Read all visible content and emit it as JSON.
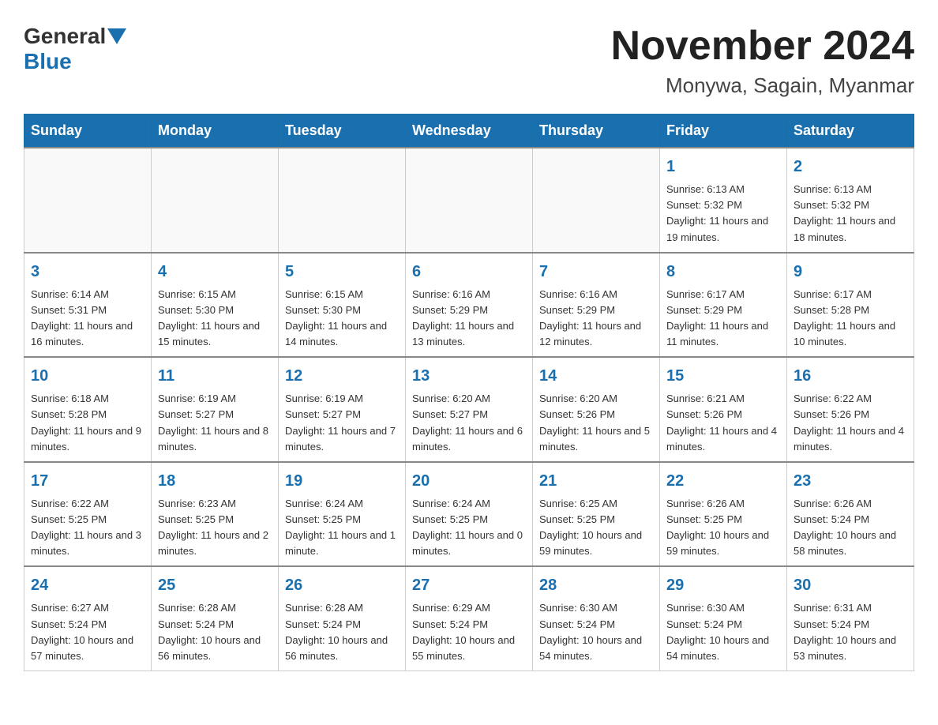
{
  "header": {
    "logo_general": "General",
    "logo_blue": "Blue",
    "month_title": "November 2024",
    "location": "Monywa, Sagain, Myanmar"
  },
  "days_of_week": [
    "Sunday",
    "Monday",
    "Tuesday",
    "Wednesday",
    "Thursday",
    "Friday",
    "Saturday"
  ],
  "weeks": [
    [
      {
        "day": "",
        "info": ""
      },
      {
        "day": "",
        "info": ""
      },
      {
        "day": "",
        "info": ""
      },
      {
        "day": "",
        "info": ""
      },
      {
        "day": "",
        "info": ""
      },
      {
        "day": "1",
        "info": "Sunrise: 6:13 AM\nSunset: 5:32 PM\nDaylight: 11 hours and 19 minutes."
      },
      {
        "day": "2",
        "info": "Sunrise: 6:13 AM\nSunset: 5:32 PM\nDaylight: 11 hours and 18 minutes."
      }
    ],
    [
      {
        "day": "3",
        "info": "Sunrise: 6:14 AM\nSunset: 5:31 PM\nDaylight: 11 hours and 16 minutes."
      },
      {
        "day": "4",
        "info": "Sunrise: 6:15 AM\nSunset: 5:30 PM\nDaylight: 11 hours and 15 minutes."
      },
      {
        "day": "5",
        "info": "Sunrise: 6:15 AM\nSunset: 5:30 PM\nDaylight: 11 hours and 14 minutes."
      },
      {
        "day": "6",
        "info": "Sunrise: 6:16 AM\nSunset: 5:29 PM\nDaylight: 11 hours and 13 minutes."
      },
      {
        "day": "7",
        "info": "Sunrise: 6:16 AM\nSunset: 5:29 PM\nDaylight: 11 hours and 12 minutes."
      },
      {
        "day": "8",
        "info": "Sunrise: 6:17 AM\nSunset: 5:29 PM\nDaylight: 11 hours and 11 minutes."
      },
      {
        "day": "9",
        "info": "Sunrise: 6:17 AM\nSunset: 5:28 PM\nDaylight: 11 hours and 10 minutes."
      }
    ],
    [
      {
        "day": "10",
        "info": "Sunrise: 6:18 AM\nSunset: 5:28 PM\nDaylight: 11 hours and 9 minutes."
      },
      {
        "day": "11",
        "info": "Sunrise: 6:19 AM\nSunset: 5:27 PM\nDaylight: 11 hours and 8 minutes."
      },
      {
        "day": "12",
        "info": "Sunrise: 6:19 AM\nSunset: 5:27 PM\nDaylight: 11 hours and 7 minutes."
      },
      {
        "day": "13",
        "info": "Sunrise: 6:20 AM\nSunset: 5:27 PM\nDaylight: 11 hours and 6 minutes."
      },
      {
        "day": "14",
        "info": "Sunrise: 6:20 AM\nSunset: 5:26 PM\nDaylight: 11 hours and 5 minutes."
      },
      {
        "day": "15",
        "info": "Sunrise: 6:21 AM\nSunset: 5:26 PM\nDaylight: 11 hours and 4 minutes."
      },
      {
        "day": "16",
        "info": "Sunrise: 6:22 AM\nSunset: 5:26 PM\nDaylight: 11 hours and 4 minutes."
      }
    ],
    [
      {
        "day": "17",
        "info": "Sunrise: 6:22 AM\nSunset: 5:25 PM\nDaylight: 11 hours and 3 minutes."
      },
      {
        "day": "18",
        "info": "Sunrise: 6:23 AM\nSunset: 5:25 PM\nDaylight: 11 hours and 2 minutes."
      },
      {
        "day": "19",
        "info": "Sunrise: 6:24 AM\nSunset: 5:25 PM\nDaylight: 11 hours and 1 minute."
      },
      {
        "day": "20",
        "info": "Sunrise: 6:24 AM\nSunset: 5:25 PM\nDaylight: 11 hours and 0 minutes."
      },
      {
        "day": "21",
        "info": "Sunrise: 6:25 AM\nSunset: 5:25 PM\nDaylight: 10 hours and 59 minutes."
      },
      {
        "day": "22",
        "info": "Sunrise: 6:26 AM\nSunset: 5:25 PM\nDaylight: 10 hours and 59 minutes."
      },
      {
        "day": "23",
        "info": "Sunrise: 6:26 AM\nSunset: 5:24 PM\nDaylight: 10 hours and 58 minutes."
      }
    ],
    [
      {
        "day": "24",
        "info": "Sunrise: 6:27 AM\nSunset: 5:24 PM\nDaylight: 10 hours and 57 minutes."
      },
      {
        "day": "25",
        "info": "Sunrise: 6:28 AM\nSunset: 5:24 PM\nDaylight: 10 hours and 56 minutes."
      },
      {
        "day": "26",
        "info": "Sunrise: 6:28 AM\nSunset: 5:24 PM\nDaylight: 10 hours and 56 minutes."
      },
      {
        "day": "27",
        "info": "Sunrise: 6:29 AM\nSunset: 5:24 PM\nDaylight: 10 hours and 55 minutes."
      },
      {
        "day": "28",
        "info": "Sunrise: 6:30 AM\nSunset: 5:24 PM\nDaylight: 10 hours and 54 minutes."
      },
      {
        "day": "29",
        "info": "Sunrise: 6:30 AM\nSunset: 5:24 PM\nDaylight: 10 hours and 54 minutes."
      },
      {
        "day": "30",
        "info": "Sunrise: 6:31 AM\nSunset: 5:24 PM\nDaylight: 10 hours and 53 minutes."
      }
    ]
  ]
}
